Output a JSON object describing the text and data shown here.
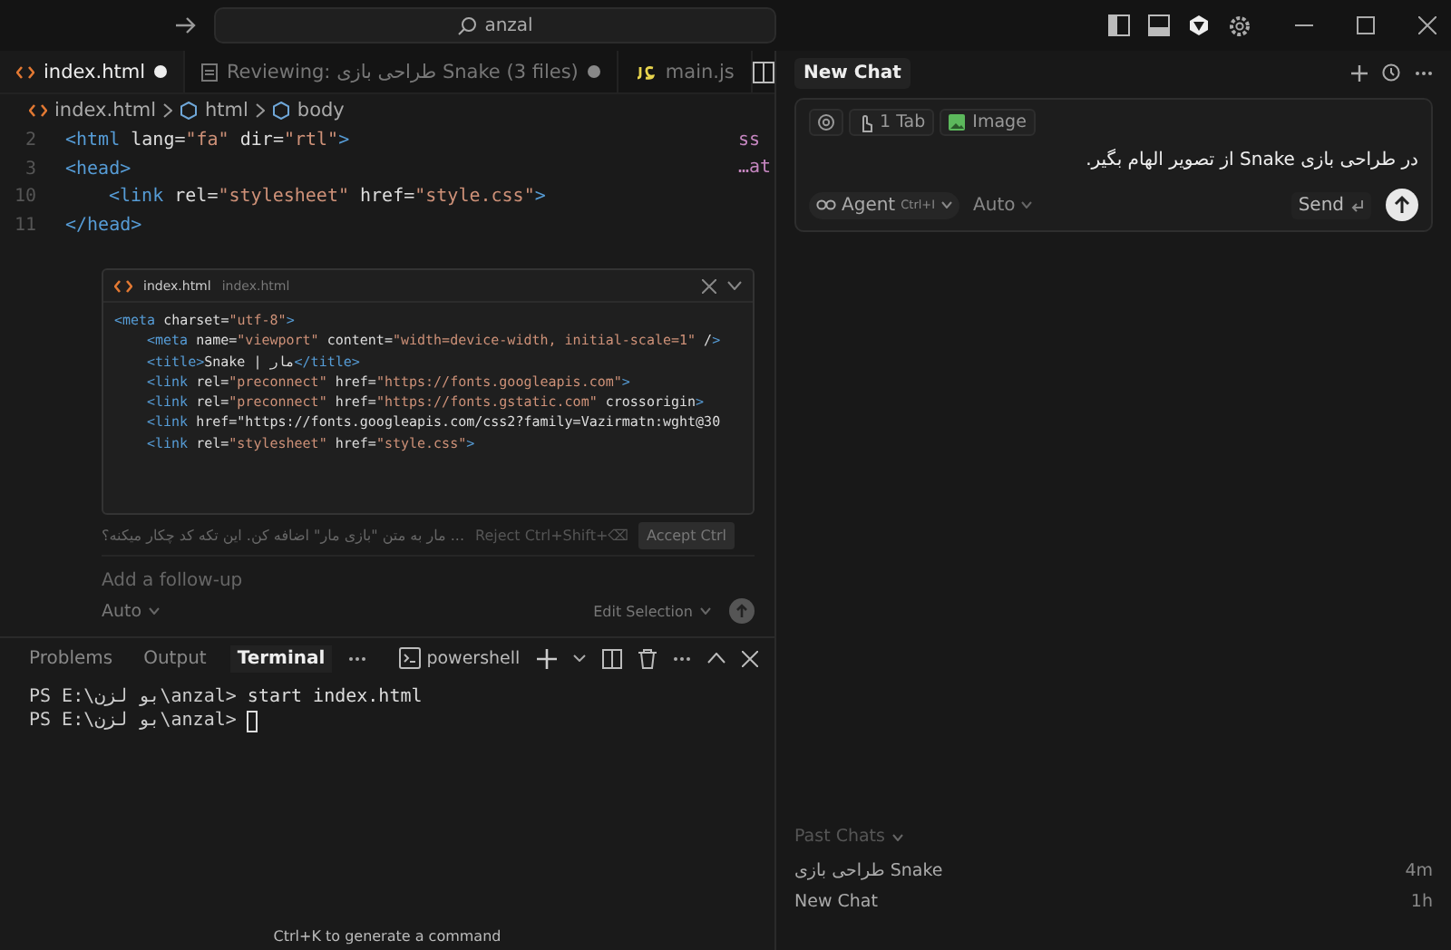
{
  "title_bar": {
    "search": "anzal"
  },
  "editor_tabs": [
    {
      "label": "index.html",
      "kind": "html",
      "modified": true,
      "selected": true
    },
    {
      "label": "Reviewing: طراحی بازی Snake (3 files)",
      "kind": "review",
      "modified": true,
      "selected": false
    },
    {
      "label": "main.js",
      "kind": "js",
      "modified": false,
      "selected": false
    }
  ],
  "breadcrumb": [
    "index.html",
    "html",
    "body"
  ],
  "code_lines": [
    {
      "number": "2",
      "text": "<html lang=\"fa\" dir=\"rtl\">"
    },
    {
      "number": "3",
      "text": "<head>",
      "children": [
        {
          "number": "10",
          "text": "<link rel=\"stylesheet\" href=\"style.css\">"
        }
      ]
    },
    {
      "number": "11",
      "text": "</head>"
    }
  ],
  "code_overflow": [
    "ss",
    "…at"
  ],
  "inline_edit": {
    "file_name": "index.html",
    "file_path": "index.html",
    "lines": [
      {
        "text": "<meta charset=\"utf-8\">",
        "children": [
          {
            "text": "<meta name=\"viewport\" content=\"width=device-width, initial-scale=1\" />"
          },
          {
            "text": "<title>Snake | مار</title>"
          },
          {
            "text": "<link rel=\"preconnect\" href=\"https://fonts.googleapis.com\">"
          },
          {
            "text": "<link rel=\"preconnect\" href=\"https://fonts.gstatic.com\" crossorigin>"
          },
          {
            "text": "<link href=\"https://fonts.googleapis.com/css2?family=Vazirmatn:wght@30"
          },
          {
            "text": "<link rel=\"stylesheet\" href=\"style.css\">"
          }
        ]
      }
    ],
    "prompt": "... مار به متن \"بازی مار\" اضافه کن. این تکه کد چکار میکنه؟",
    "reject": "Reject Ctrl+Shift+⌫",
    "accept": "Accept Ctrl",
    "followup_placeholder": "Add a follow-up",
    "model": "Auto",
    "mode": "Edit Selection"
  },
  "panel_tabs": [
    {
      "label": "Problems",
      "selected": false
    },
    {
      "label": "Output",
      "selected": false
    },
    {
      "label": "Terminal",
      "selected": true
    }
  ],
  "terminal": {
    "shell": "powershell",
    "lines": [
      {
        "prompt": "PS E:\\بو لزن\\anzal> ",
        "command": "start index.html",
        "cursor": false
      },
      {
        "prompt": "PS E:\\بو لزن\\anzal> ",
        "cursor": true
      }
    ]
  },
  "terminal_hint": "Ctrl+K to generate a command",
  "chat": {
    "title": "New Chat",
    "context_chips": [
      {
        "label": "1 Tab",
        "kind": "tab"
      },
      {
        "label": "Image",
        "kind": "image"
      }
    ],
    "message": "در طراحی بازی Snake از تصویر الهام بگیر.",
    "agent": "Agent",
    "agent_shortcut": "Ctrl+I",
    "model": "Auto",
    "send": "Send"
  },
  "past_chats": {
    "heading": "Past Chats",
    "items": [
      {
        "title": "طراحی بازی Snake",
        "time": "4m"
      },
      {
        "title": "New Chat",
        "time": "1h"
      }
    ]
  }
}
